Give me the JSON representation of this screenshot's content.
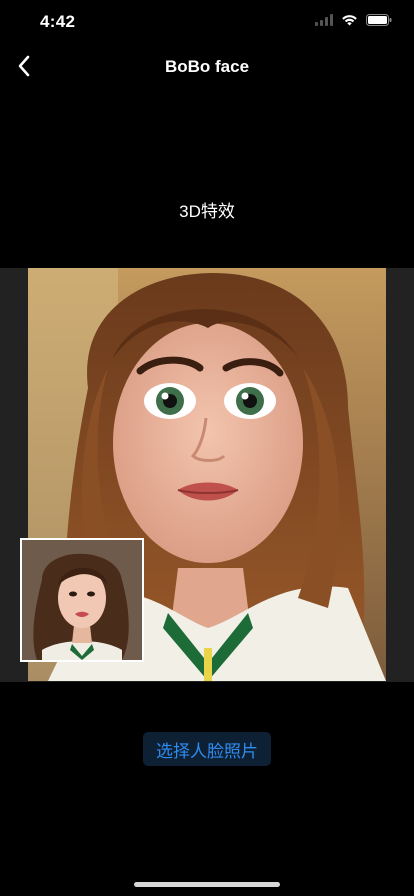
{
  "status_bar": {
    "time": "4:42",
    "icons": [
      "signal-icon",
      "wifi-icon",
      "battery-icon"
    ]
  },
  "nav": {
    "title": "BoBo face",
    "back_icon": "chevron-left-icon"
  },
  "effect": {
    "label": "3D特效"
  },
  "preview": {
    "result_image": "cartoon-3d-face-portrait",
    "original_thumbnail": "original-face-photo"
  },
  "actions": {
    "select_photo_label": "选择人脸照片"
  },
  "colors": {
    "background": "#000000",
    "panel": "#222222",
    "button_bg": "#0d2034",
    "button_text": "#2e8cf0"
  }
}
